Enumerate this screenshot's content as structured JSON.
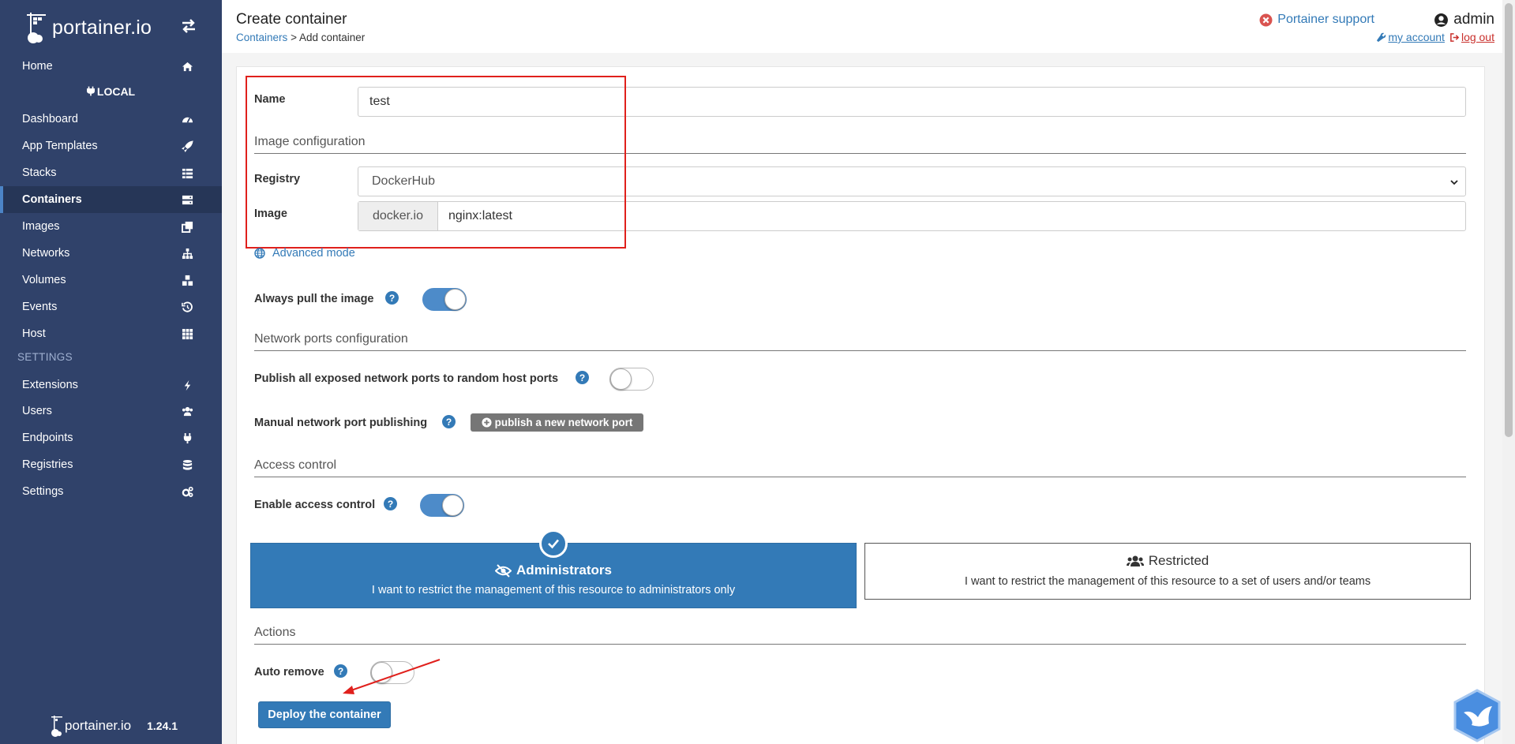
{
  "brand": {
    "name": "portainer.io"
  },
  "sidebar": {
    "home": "Home",
    "environment": "LOCAL",
    "items": [
      {
        "label": "Dashboard",
        "icon": "tachometer-icon"
      },
      {
        "label": "App Templates",
        "icon": "rocket-icon"
      },
      {
        "label": "Stacks",
        "icon": "th-list-icon"
      },
      {
        "label": "Containers",
        "icon": "server-icon",
        "active": true
      },
      {
        "label": "Images",
        "icon": "clone-icon"
      },
      {
        "label": "Networks",
        "icon": "sitemap-icon"
      },
      {
        "label": "Volumes",
        "icon": "cubes-icon"
      },
      {
        "label": "Events",
        "icon": "history-icon"
      },
      {
        "label": "Host",
        "icon": "th-icon"
      }
    ],
    "settings_heading": "SETTINGS",
    "settings_items": [
      {
        "label": "Extensions",
        "icon": "bolt-icon"
      },
      {
        "label": "Users",
        "icon": "users-icon"
      },
      {
        "label": "Endpoints",
        "icon": "plug-icon"
      },
      {
        "label": "Registries",
        "icon": "database-icon"
      },
      {
        "label": "Settings",
        "icon": "cogs-icon"
      }
    ],
    "footer": {
      "brand": "portainer.io",
      "version": "1.24.1"
    }
  },
  "header": {
    "title": "Create container",
    "breadcrumb_link": "Containers",
    "breadcrumb_separator": ">",
    "breadcrumb_current": "Add container",
    "support": "Portainer support",
    "user": "admin",
    "my_account": "my account",
    "log_out": "log out"
  },
  "form": {
    "name_label": "Name",
    "name_value": "test",
    "image_section": "Image configuration",
    "registry_label": "Registry",
    "registry_value": "DockerHub",
    "image_label": "Image",
    "image_prefix": "docker.io",
    "image_value": "nginx:latest",
    "advanced_mode": "Advanced mode",
    "always_pull_label": "Always pull the image",
    "always_pull": true,
    "network_section": "Network ports configuration",
    "publish_all_label": "Publish all exposed network ports to random host ports",
    "publish_all": false,
    "manual_publish_label": "Manual network port publishing",
    "publish_button": "publish a new network port",
    "access_section": "Access control",
    "enable_access_label": "Enable access control",
    "enable_access": true,
    "admin_title": "Administrators",
    "admin_desc": "I want to restrict the management of this resource to administrators only",
    "restricted_title": "Restricted",
    "restricted_desc": "I want to restrict the management of this resource to a set of users and/or teams",
    "actions_section": "Actions",
    "auto_remove_label": "Auto remove",
    "auto_remove": false,
    "deploy_button": "Deploy the container"
  },
  "colors": {
    "sidebar": "#30426a",
    "primary": "#337ab7",
    "annotation": "#e0201c"
  }
}
